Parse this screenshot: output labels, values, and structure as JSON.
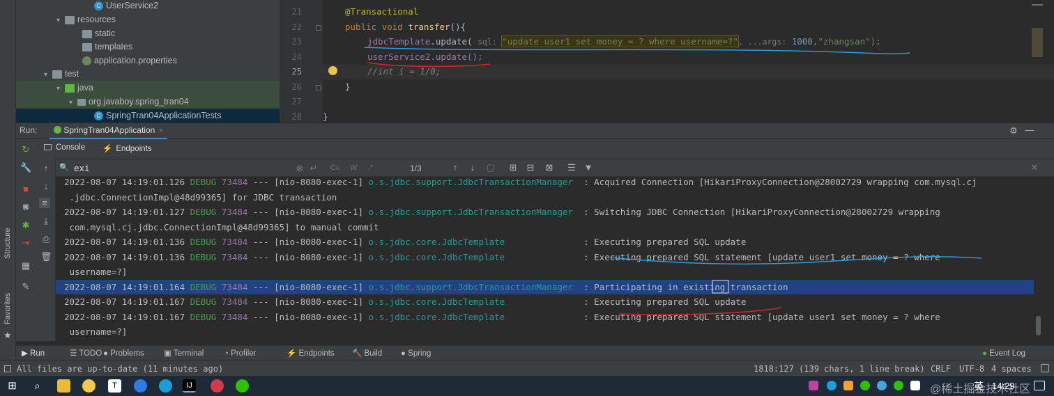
{
  "project_tree": [
    {
      "label": "UserService2",
      "kind": "class"
    },
    {
      "label": "resources",
      "kind": "folder"
    },
    {
      "label": "static",
      "kind": "folder"
    },
    {
      "label": "templates",
      "kind": "folder"
    },
    {
      "label": "application.properties",
      "kind": "properties"
    },
    {
      "label": "test",
      "kind": "folder"
    },
    {
      "label": "java",
      "kind": "folder"
    },
    {
      "label": "org.javaboy.spring_tran04",
      "kind": "package"
    },
    {
      "label": "SpringTran04ApplicationTests",
      "kind": "class"
    }
  ],
  "editor": {
    "line_numbers": [
      "21",
      "22",
      "23",
      "24",
      "25",
      "26",
      "27",
      "28"
    ],
    "code": {
      "annotation": "@Transactional",
      "kw_public": "public",
      "kw_void": "void",
      "method": "transfer",
      "l22_rest": "(){",
      "l23_obj": "jdbcTemplate",
      "l23_call": ".update(",
      "l23_hint_sql": "sql:",
      "l23_str": "\"update user1 set money = ? where username=?\"",
      "l23_hint_args": ", ...args:",
      "l23_num": "1000",
      "l23_str2": ",\"zhangsan\");",
      "l24": "userService2.update();",
      "l25": "//int i = 1/0;",
      "l26": "}",
      "l28": "}"
    }
  },
  "run_panel": {
    "label": "Run:",
    "config_tab": "SpringTran04Application",
    "subtabs": [
      "Console",
      "Endpoints"
    ],
    "search_value": "exi",
    "match_count": "1/3"
  },
  "console_lines": [
    {
      "text": "2022-08-07 14:19:01.126 DEBUG 73484 --- [nio-8080-exec-1] o.s.jdbc.support.JdbcTransactionManager  : Acquired Connection [HikariProxyConnection@28002729 wrapping com.mysql.cj"
    },
    {
      "text": " .jdbc.ConnectionImpl@48d99365] for JDBC transaction"
    },
    {
      "text": "2022-08-07 14:19:01.127 DEBUG 73484 --- [nio-8080-exec-1] o.s.jdbc.support.JdbcTransactionManager  : Switching JDBC Connection [HikariProxyConnection@28002729 wrapping"
    },
    {
      "text": " com.mysql.cj.jdbc.ConnectionImpl@48d99365] to manual commit"
    },
    {
      "text": "2022-08-07 14:19:01.136 DEBUG 73484 --- [nio-8080-exec-1] o.s.jdbc.core.JdbcTemplate               : Executing prepared SQL update"
    },
    {
      "text": "2022-08-07 14:19:01.136 DEBUG 73484 --- [nio-8080-exec-1] o.s.jdbc.core.JdbcTemplate               : Executing prepared SQL statement [update user1 set money = ? where"
    },
    {
      "text": " username=?]"
    },
    {
      "text": "2022-08-07 14:19:01.164 DEBUG 73484 --- [nio-8080-exec-1] o.s.jdbc.support.JdbcTransactionManager  : Participating in existing transaction"
    },
    {
      "text": "2022-08-07 14:19:01.167 DEBUG 73484 --- [nio-8080-exec-1] o.s.jdbc.core.JdbcTemplate               : Executing prepared SQL update"
    },
    {
      "text": "2022-08-07 14:19:01.167 DEBUG 73484 --- [nio-8080-exec-1] o.s.jdbc.core.JdbcTemplate               : Executing prepared SQL statement [update user1 set money = ? where"
    },
    {
      "text": " username=?]"
    }
  ],
  "left_tool_tabs": [
    "Structure",
    "Favorites"
  ],
  "bottom_tabs": [
    "Run",
    "TODO",
    "Problems",
    "Terminal",
    "Profiler",
    "Endpoints",
    "Build",
    "Spring"
  ],
  "event_log": "Event Log",
  "status": {
    "left": "All files are up-to-date (11 minutes ago)",
    "position": "1818:127 (139 chars, 1 line break)",
    "line_sep": "CRLF",
    "encoding": "UTF-8",
    "indent": "4 spaces"
  },
  "taskbar": {
    "ime": "英",
    "time": "14:29",
    "watermark": "@稀土掘金技术社区"
  },
  "colors": {
    "selection": "#214283",
    "debug": "#499c54",
    "logger": "#299999",
    "blue_annotation": "#2f9bd6",
    "red_annotation": "#d0262d"
  }
}
